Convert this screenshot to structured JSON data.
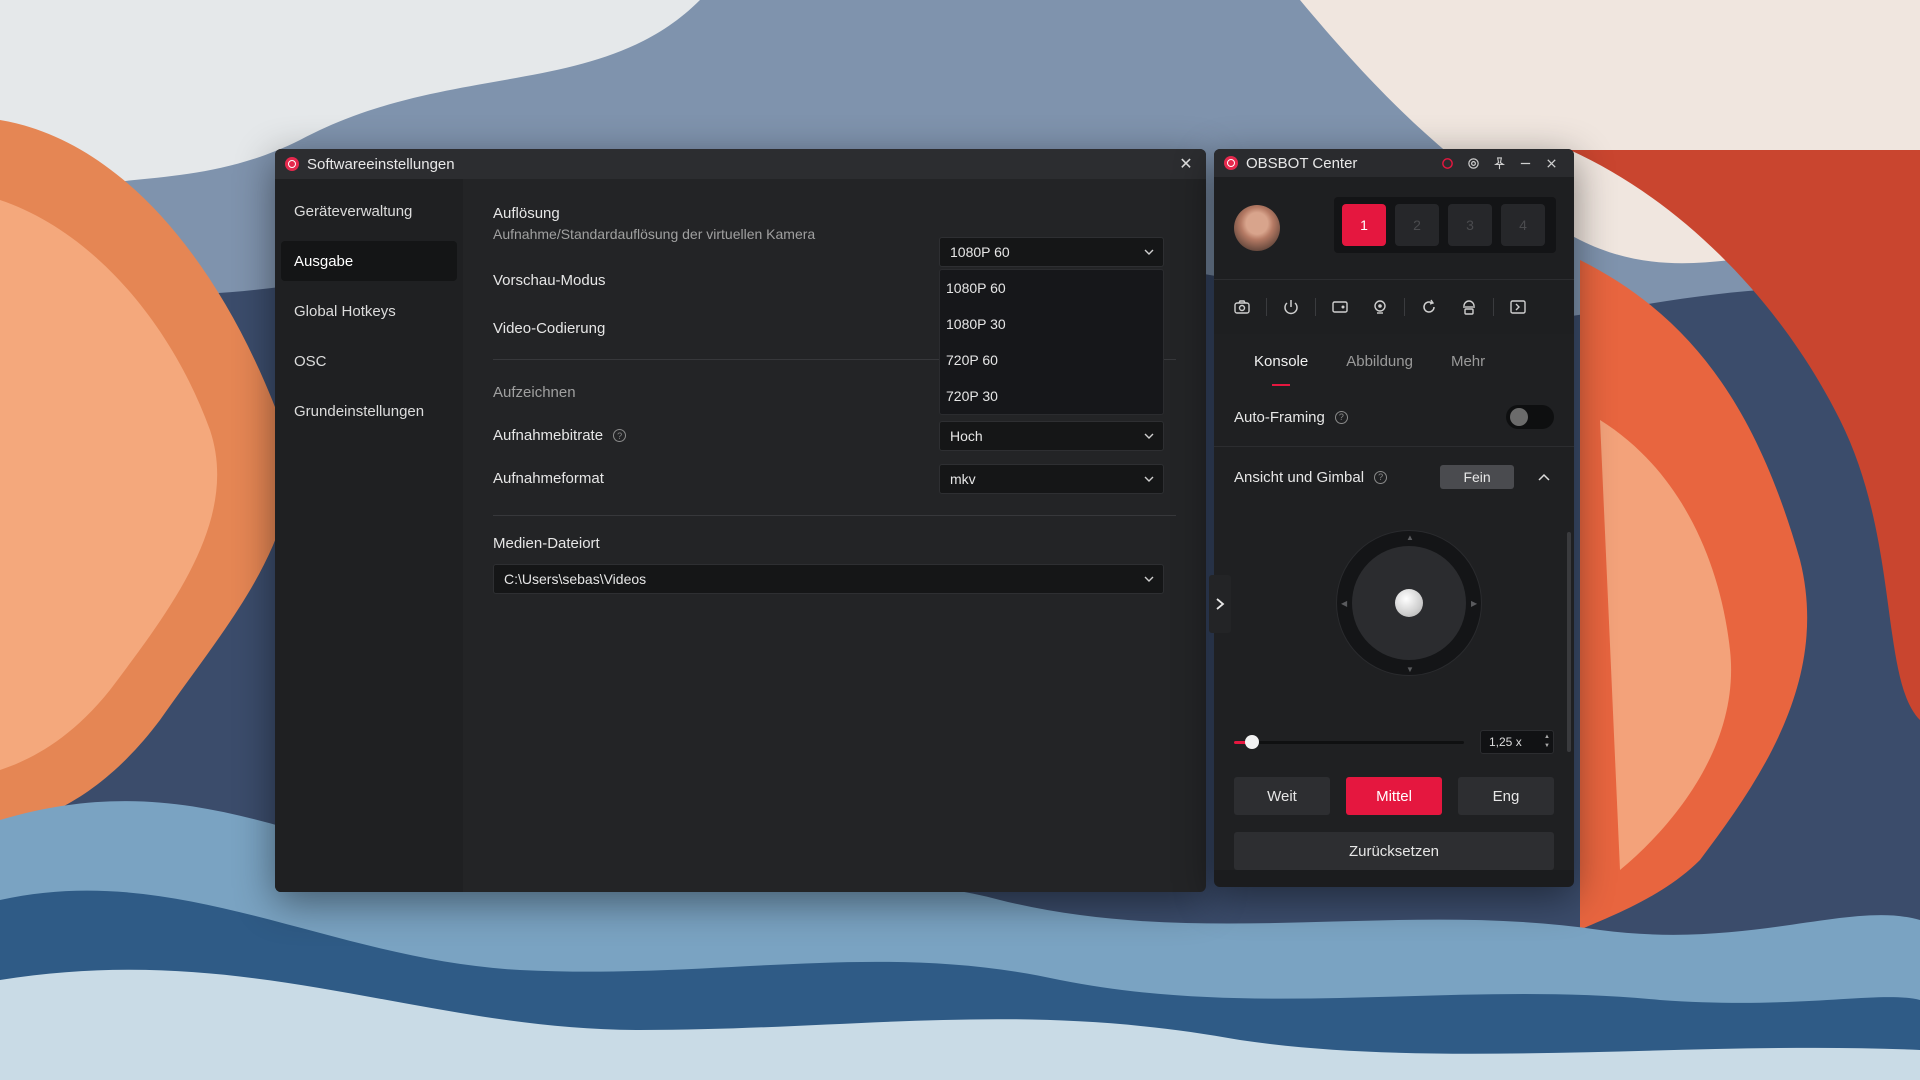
{
  "settings": {
    "title": "Softwareeinstellungen",
    "nav": [
      {
        "label": "Geräteverwaltung",
        "active": false
      },
      {
        "label": "Ausgabe",
        "active": true
      },
      {
        "label": "Global Hotkeys",
        "active": false
      },
      {
        "label": "OSC",
        "active": false
      },
      {
        "label": "Grundeinstellungen",
        "active": false
      }
    ],
    "resolution": {
      "label": "Auflösung",
      "sub": "Aufnahme/Standardauflösung der virtuellen Kamera",
      "value": "1080P 60",
      "options": [
        "1080P 60",
        "1080P 30",
        "720P 60",
        "720P 30"
      ]
    },
    "preview_mode": {
      "label": "Vorschau-Modus"
    },
    "video_encoding": {
      "label": "Video-Codierung"
    },
    "record_section": "Aufzeichnen",
    "bitrate": {
      "label": "Aufnahmebitrate",
      "value": "Hoch"
    },
    "format": {
      "label": "Aufnahmeformat",
      "value": "mkv"
    },
    "media": {
      "label": "Medien-Dateiort",
      "path": "C:\\Users\\sebas\\Videos"
    }
  },
  "obsbot": {
    "title": "OBSBOT Center",
    "slots": [
      "1",
      "2",
      "3",
      "4"
    ],
    "active_slot": 0,
    "tabs": [
      {
        "label": "Konsole",
        "active": true
      },
      {
        "label": "Abbildung",
        "active": false
      },
      {
        "label": "Mehr",
        "active": false
      }
    ],
    "auto_framing": {
      "label": "Auto-Framing",
      "on": false
    },
    "gimbal": {
      "label": "Ansicht und Gimbal",
      "mode": "Fein"
    },
    "zoom": {
      "value": "1,25 x",
      "level": 0.08
    },
    "presets": [
      {
        "label": "Weit",
        "active": false
      },
      {
        "label": "Mittel",
        "active": true
      },
      {
        "label": "Eng",
        "active": false
      }
    ],
    "reset_label": "Zurücksetzen"
  },
  "colors": {
    "accent": "#e5173f",
    "window_bg": "#232426"
  }
}
